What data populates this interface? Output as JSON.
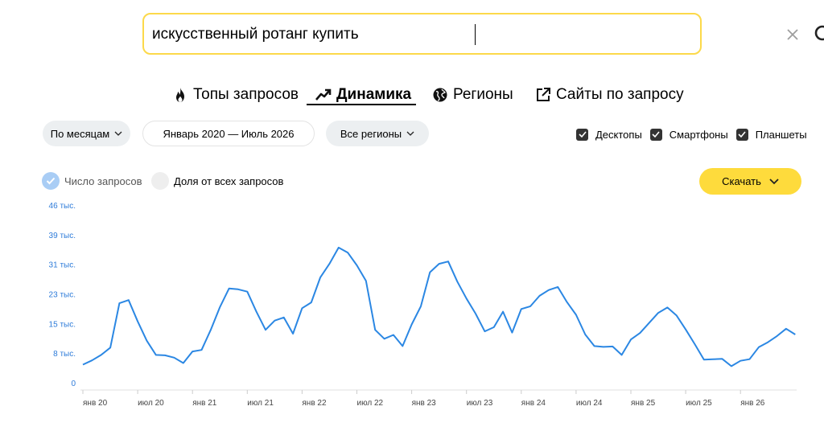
{
  "search": {
    "query": "искусственный ротанг купить",
    "clear_icon": "close-icon",
    "search_icon": "search-icon"
  },
  "tabs": [
    {
      "label": "Топы запросов",
      "icon": "fire-icon",
      "active": false
    },
    {
      "label": "Динамика",
      "icon": "trend-icon",
      "active": true
    },
    {
      "label": "Регионы",
      "icon": "globe-icon",
      "active": false
    },
    {
      "label": "Сайты по запросу",
      "icon": "external-link-icon",
      "active": false
    }
  ],
  "filters": {
    "period_group": "По месяцам",
    "date_range": "Январь 2020 — Июль 2026",
    "regions": "Все регионы"
  },
  "devices": [
    {
      "label": "Десктопы",
      "checked": true
    },
    {
      "label": "Смартфоны",
      "checked": true
    },
    {
      "label": "Планшеты",
      "checked": true
    }
  ],
  "metric": {
    "count_label": "Число запросов",
    "share_label": "Доля от всех запросов",
    "selected": "count"
  },
  "download_label": "Скачать",
  "colors": {
    "accent_yellow": "#fedb3c",
    "line_blue": "#2b87e3",
    "checkbox_dark": "#333333"
  },
  "chart_data": {
    "type": "line",
    "ylim": [
      0,
      46000
    ],
    "y_ticks": [
      {
        "value": 0,
        "label": "0"
      },
      {
        "value": 7667,
        "label": "8 тыс."
      },
      {
        "value": 15333,
        "label": "15 тыс."
      },
      {
        "value": 23000,
        "label": "23 тыс."
      },
      {
        "value": 30667,
        "label": "31 тыс."
      },
      {
        "value": 38333,
        "label": "39 тыс."
      },
      {
        "value": 46000,
        "label": "46 тыс."
      }
    ],
    "x_ticks": [
      {
        "index": 0,
        "label": "янв 20"
      },
      {
        "index": 6,
        "label": "июл 20"
      },
      {
        "index": 12,
        "label": "янв 21"
      },
      {
        "index": 18,
        "label": "июл 21"
      },
      {
        "index": 24,
        "label": "янв 22"
      },
      {
        "index": 30,
        "label": "июл 22"
      },
      {
        "index": 36,
        "label": "янв 23"
      },
      {
        "index": 42,
        "label": "июл 23"
      },
      {
        "index": 48,
        "label": "янв 24"
      },
      {
        "index": 54,
        "label": "июл 24"
      },
      {
        "index": 60,
        "label": "янв 25"
      },
      {
        "index": 66,
        "label": "июл 25"
      },
      {
        "index": 72,
        "label": "янв 26"
      }
    ],
    "values": [
      4900,
      6000,
      7400,
      9300,
      20800,
      21600,
      16100,
      11100,
      7400,
      7300,
      6700,
      5300,
      8300,
      8700,
      13900,
      19800,
      24600,
      24400,
      23800,
      18600,
      13900,
      16300,
      17100,
      12900,
      19500,
      21000,
      27500,
      31000,
      35200,
      33900,
      30600,
      26600,
      13900,
      11600,
      12600,
      9700,
      15300,
      20000,
      28800,
      31000,
      31600,
      26400,
      22000,
      18100,
      13500,
      14600,
      18600,
      13200,
      19300,
      20000,
      22700,
      24200,
      25000,
      21100,
      17800,
      12700,
      9700,
      9500,
      9600,
      7400,
      11400,
      13100,
      15700,
      18300,
      19700,
      17600,
      14000,
      10200,
      6200,
      6300,
      6400,
      4500,
      5900,
      6300,
      9400,
      10700,
      12300,
      14200,
      12700
    ]
  }
}
